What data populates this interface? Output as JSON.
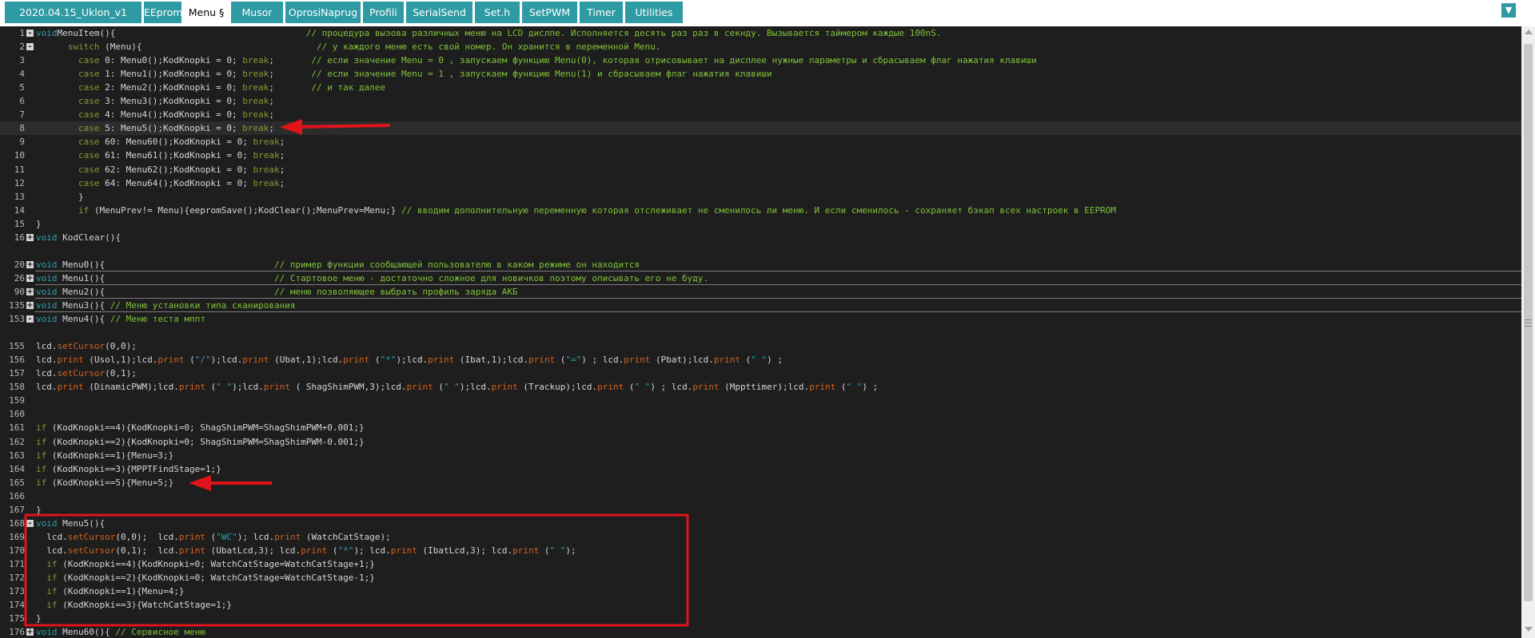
{
  "tabs": [
    {
      "label": "2020.04.15_Uklon_v1"
    },
    {
      "label": "EEprom"
    },
    {
      "label": "Menu §",
      "active": true
    },
    {
      "label": "Musor"
    },
    {
      "label": "OprosiNaprug"
    },
    {
      "label": "Profili"
    },
    {
      "label": "SerialSend"
    },
    {
      "label": "Set.h"
    },
    {
      "label": "SetPWM"
    },
    {
      "label": "Timer"
    },
    {
      "label": "Utilities"
    }
  ],
  "tab_menu_icon": "chevron-down-icon",
  "accent_color": "#2e9aa3",
  "annotation_color": "#e0141a",
  "lines": [
    {
      "n": "1",
      "fold": "-",
      "tokens": [
        [
          "ty",
          "void"
        ],
        [
          "",
          "MenuItem(){"
        ],
        [
          "",
          "                                    "
        ],
        [
          "cm",
          "// процедура вызова различных меню на LCD дислпе. Исполняется десять раз раз в секнду. Вызывается таймером каждые 100nS."
        ]
      ]
    },
    {
      "n": "2",
      "fold": "-",
      "tokens": [
        [
          "",
          "      "
        ],
        [
          "kw",
          "switch"
        ],
        [
          "",
          " (Menu){                                 "
        ],
        [
          "cm",
          "// у каждого меню есть свой номер. Он хранится в переменной Menu."
        ]
      ]
    },
    {
      "n": "3",
      "tokens": [
        [
          "",
          "        "
        ],
        [
          "kw",
          "case"
        ],
        [
          "",
          " 0: Menu0();KodKnopki = 0; "
        ],
        [
          "kw",
          "break"
        ],
        [
          "",
          ";       "
        ],
        [
          "cm",
          "// если значение Menu = 0 , запускаем функцию Menu(0), которая отрисовывает на дисплее нужные параметры и сбрасываем флаг нажатия клавиши"
        ]
      ]
    },
    {
      "n": "4",
      "tokens": [
        [
          "",
          "        "
        ],
        [
          "kw",
          "case"
        ],
        [
          "",
          " 1: Menu1();KodKnopki = 0; "
        ],
        [
          "kw",
          "break"
        ],
        [
          "",
          ";       "
        ],
        [
          "cm",
          "// если значение Menu = 1 , запускаем функцию Menu(1) и сбрасываем флаг нажатия клавиши"
        ]
      ]
    },
    {
      "n": "5",
      "tokens": [
        [
          "",
          "        "
        ],
        [
          "kw",
          "case"
        ],
        [
          "",
          " 2: Menu2();KodKnopki = 0; "
        ],
        [
          "kw",
          "break"
        ],
        [
          "",
          ";       "
        ],
        [
          "cm",
          "// и так далее"
        ]
      ]
    },
    {
      "n": "6",
      "tokens": [
        [
          "",
          "        "
        ],
        [
          "kw",
          "case"
        ],
        [
          "",
          " 3: Menu3();KodKnopki = 0; "
        ],
        [
          "kw",
          "break"
        ],
        [
          "",
          ";"
        ]
      ]
    },
    {
      "n": "7",
      "tokens": [
        [
          "",
          "        "
        ],
        [
          "kw",
          "case"
        ],
        [
          "",
          " 4: Menu4();KodKnopki = 0; "
        ],
        [
          "kw",
          "break"
        ],
        [
          "",
          ";"
        ]
      ]
    },
    {
      "n": "8",
      "cur": true,
      "tokens": [
        [
          "",
          "        "
        ],
        [
          "kw",
          "case"
        ],
        [
          "",
          " 5: Menu5();KodKnopki = 0; "
        ],
        [
          "kw",
          "break"
        ],
        [
          "",
          ";"
        ]
      ]
    },
    {
      "n": "9",
      "tokens": [
        [
          "",
          "        "
        ],
        [
          "kw",
          "case"
        ],
        [
          "",
          " 60: Menu60();KodKnopki = 0; "
        ],
        [
          "kw",
          "break"
        ],
        [
          "",
          ";"
        ]
      ]
    },
    {
      "n": "10",
      "tokens": [
        [
          "",
          "        "
        ],
        [
          "kw",
          "case"
        ],
        [
          "",
          " 61: Menu61();KodKnopki = 0; "
        ],
        [
          "kw",
          "break"
        ],
        [
          "",
          ";"
        ]
      ]
    },
    {
      "n": "11",
      "tokens": [
        [
          "",
          "        "
        ],
        [
          "kw",
          "case"
        ],
        [
          "",
          " 62: Menu62();KodKnopki = 0; "
        ],
        [
          "kw",
          "break"
        ],
        [
          "",
          ";"
        ]
      ]
    },
    {
      "n": "12",
      "tokens": [
        [
          "",
          "        "
        ],
        [
          "kw",
          "case"
        ],
        [
          "",
          " 64: Menu64();KodKnopki = 0; "
        ],
        [
          "kw",
          "break"
        ],
        [
          "",
          ";"
        ]
      ]
    },
    {
      "n": "13",
      "tokens": [
        [
          "",
          "        }"
        ]
      ]
    },
    {
      "n": "14",
      "tokens": [
        [
          "",
          "        "
        ],
        [
          "kw",
          "if"
        ],
        [
          "",
          " (MenuPrev!= Menu){eepromSave();KodClear();MenuPrev=Menu;} "
        ],
        [
          "cm",
          "// вводим дополнительную переменную которая отслеживает не сменилось ли меню. И если сменилось - сохраняет бэкап всех настроек в EEPROM"
        ]
      ]
    },
    {
      "n": "15",
      "tokens": [
        [
          "",
          "}"
        ]
      ]
    },
    {
      "n": "16",
      "fold": "+",
      "tokens": [
        [
          "ty",
          "void"
        ],
        [
          "",
          " KodClear(){"
        ]
      ]
    },
    {
      "n": "",
      "tokens": []
    },
    {
      "n": "20",
      "fold": "+",
      "sep": true,
      "tokens": [
        [
          "ty",
          "void"
        ],
        [
          "",
          " Menu0(){                                "
        ],
        [
          "cm",
          "// пример функции сообщающей пользователю в каком режиме он находится"
        ]
      ]
    },
    {
      "n": "26",
      "fold": "+",
      "sep": true,
      "tokens": [
        [
          "ty",
          "void"
        ],
        [
          "",
          " Menu1(){                                "
        ],
        [
          "cm",
          "// Стартовое меню - достаточно сложное для новичков поэтому описывать его не буду."
        ]
      ]
    },
    {
      "n": "90",
      "fold": "+",
      "sep": true,
      "tokens": [
        [
          "ty",
          "void"
        ],
        [
          "",
          " Menu2(){                                "
        ],
        [
          "cm",
          "// меню позволяющее выбрать профиль заряда АКБ"
        ]
      ]
    },
    {
      "n": "135",
      "fold": "+",
      "sep": true,
      "tokens": [
        [
          "ty",
          "void"
        ],
        [
          "",
          " Menu3(){ "
        ],
        [
          "cm",
          "// Меню установки типа сканирования"
        ]
      ]
    },
    {
      "n": "153",
      "fold": "-",
      "tokens": [
        [
          "ty",
          "void"
        ],
        [
          "",
          " Menu4(){ "
        ],
        [
          "cm",
          "// Меню теста мппт"
        ]
      ]
    },
    {
      "n": "",
      "tokens": []
    },
    {
      "n": "155",
      "tokens": [
        [
          "",
          "lcd."
        ],
        [
          "fn",
          "setCursor"
        ],
        [
          "",
          "(0,0);"
        ]
      ]
    },
    {
      "n": "156",
      "tokens": [
        [
          "",
          "lcd."
        ],
        [
          "fn",
          "print"
        ],
        [
          "",
          " (Usol,1);lcd."
        ],
        [
          "fn",
          "print"
        ],
        [
          "",
          " ("
        ],
        [
          "str",
          "\"/\""
        ],
        [
          "",
          ");lcd."
        ],
        [
          "fn",
          "print"
        ],
        [
          "",
          " (Ubat,1);lcd."
        ],
        [
          "fn",
          "print"
        ],
        [
          "",
          " ("
        ],
        [
          "str",
          "\"*\""
        ],
        [
          "",
          ");lcd."
        ],
        [
          "fn",
          "print"
        ],
        [
          "",
          " (Ibat,1);lcd."
        ],
        [
          "fn",
          "print"
        ],
        [
          "",
          " ("
        ],
        [
          "str",
          "\"=\""
        ],
        [
          "",
          ") ; lcd."
        ],
        [
          "fn",
          "print"
        ],
        [
          "",
          " (Pbat);lcd."
        ],
        [
          "fn",
          "print"
        ],
        [
          "",
          " ("
        ],
        [
          "str",
          "\" \""
        ],
        [
          "",
          ") ;"
        ]
      ]
    },
    {
      "n": "157",
      "tokens": [
        [
          "",
          "lcd."
        ],
        [
          "fn",
          "setCursor"
        ],
        [
          "",
          "(0,1);"
        ]
      ]
    },
    {
      "n": "158",
      "tokens": [
        [
          "",
          "lcd."
        ],
        [
          "fn",
          "print"
        ],
        [
          "",
          " (DinamicPWM);lcd."
        ],
        [
          "fn",
          "print"
        ],
        [
          "",
          " ("
        ],
        [
          "str",
          "\" \""
        ],
        [
          "",
          ");lcd."
        ],
        [
          "fn",
          "print"
        ],
        [
          "",
          " ( ShagShimPWM,3);lcd."
        ],
        [
          "fn",
          "print"
        ],
        [
          "",
          " ("
        ],
        [
          "str",
          "\" \""
        ],
        [
          "",
          ");lcd."
        ],
        [
          "fn",
          "print"
        ],
        [
          "",
          " (Trackup);lcd."
        ],
        [
          "fn",
          "print"
        ],
        [
          "",
          " ("
        ],
        [
          "str",
          "\" \""
        ],
        [
          "",
          ") ; lcd."
        ],
        [
          "fn",
          "print"
        ],
        [
          "",
          " (Mppttimer);lcd."
        ],
        [
          "fn",
          "print"
        ],
        [
          "",
          " ("
        ],
        [
          "str",
          "\" \""
        ],
        [
          "",
          ") ;"
        ]
      ]
    },
    {
      "n": "159",
      "tokens": []
    },
    {
      "n": "160",
      "tokens": []
    },
    {
      "n": "161",
      "tokens": [
        [
          "kw",
          "if"
        ],
        [
          "",
          " (KodKnopki==4){KodKnopki=0; ShagShimPWM=ShagShimPWM+0.001;}"
        ]
      ]
    },
    {
      "n": "162",
      "tokens": [
        [
          "kw",
          "if"
        ],
        [
          "",
          " (KodKnopki==2){KodKnopki=0; ShagShimPWM=ShagShimPWM-0.001;}"
        ]
      ]
    },
    {
      "n": "163",
      "tokens": [
        [
          "kw",
          "if"
        ],
        [
          "",
          " (KodKnopki==1){Menu=3;}"
        ]
      ]
    },
    {
      "n": "164",
      "tokens": [
        [
          "kw",
          "if"
        ],
        [
          "",
          " (KodKnopki==3){MPPTFindStage=1;}"
        ]
      ]
    },
    {
      "n": "165",
      "tokens": [
        [
          "kw",
          "if"
        ],
        [
          "",
          " (KodKnopki==5){Menu=5;}"
        ]
      ]
    },
    {
      "n": "166",
      "tokens": []
    },
    {
      "n": "167",
      "tokens": [
        [
          "",
          "}"
        ]
      ]
    },
    {
      "n": "168",
      "fold": "-",
      "tokens": [
        [
          "ty",
          "void"
        ],
        [
          "",
          " Menu5(){"
        ]
      ]
    },
    {
      "n": "169",
      "tokens": [
        [
          "",
          "  lcd."
        ],
        [
          "fn",
          "setCursor"
        ],
        [
          "",
          "(0,0);  lcd."
        ],
        [
          "fn",
          "print"
        ],
        [
          "",
          " ("
        ],
        [
          "str",
          "\"WC\""
        ],
        [
          "",
          "); lcd."
        ],
        [
          "fn",
          "print"
        ],
        [
          "",
          " (WatchCatStage);"
        ]
      ]
    },
    {
      "n": "170",
      "tokens": [
        [
          "",
          "  lcd."
        ],
        [
          "fn",
          "setCursor"
        ],
        [
          "",
          "(0,1);  lcd."
        ],
        [
          "fn",
          "print"
        ],
        [
          "",
          " (UbatLcd,3); lcd."
        ],
        [
          "fn",
          "print"
        ],
        [
          "",
          " ("
        ],
        [
          "str",
          "\"*\""
        ],
        [
          "",
          "); lcd."
        ],
        [
          "fn",
          "print"
        ],
        [
          "",
          " (IbatLcd,3); lcd."
        ],
        [
          "fn",
          "print"
        ],
        [
          "",
          " ("
        ],
        [
          "str",
          "\" \""
        ],
        [
          "",
          ");"
        ]
      ]
    },
    {
      "n": "171",
      "tokens": [
        [
          "",
          "  "
        ],
        [
          "kw",
          "if"
        ],
        [
          "",
          " (KodKnopki==4){KodKnopki=0; WatchCatStage=WatchCatStage+1;}"
        ]
      ]
    },
    {
      "n": "172",
      "tokens": [
        [
          "",
          "  "
        ],
        [
          "kw",
          "if"
        ],
        [
          "",
          " (KodKnopki==2){KodKnopki=0; WatchCatStage=WatchCatStage-1;}"
        ]
      ]
    },
    {
      "n": "173",
      "tokens": [
        [
          "",
          "  "
        ],
        [
          "kw",
          "if"
        ],
        [
          "",
          " (KodKnopki==1){Menu=4;}"
        ]
      ]
    },
    {
      "n": "174",
      "tokens": [
        [
          "",
          "  "
        ],
        [
          "kw",
          "if"
        ],
        [
          "",
          " (KodKnopki==3){WatchCatStage=1;}"
        ]
      ]
    },
    {
      "n": "175",
      "tokens": [
        [
          "",
          "}"
        ]
      ]
    },
    {
      "n": "176",
      "fold": "+",
      "tokens": [
        [
          "ty",
          "void"
        ],
        [
          "",
          " Menu60(){ "
        ],
        [
          "cm",
          "// Сервисное меню"
        ]
      ]
    }
  ]
}
